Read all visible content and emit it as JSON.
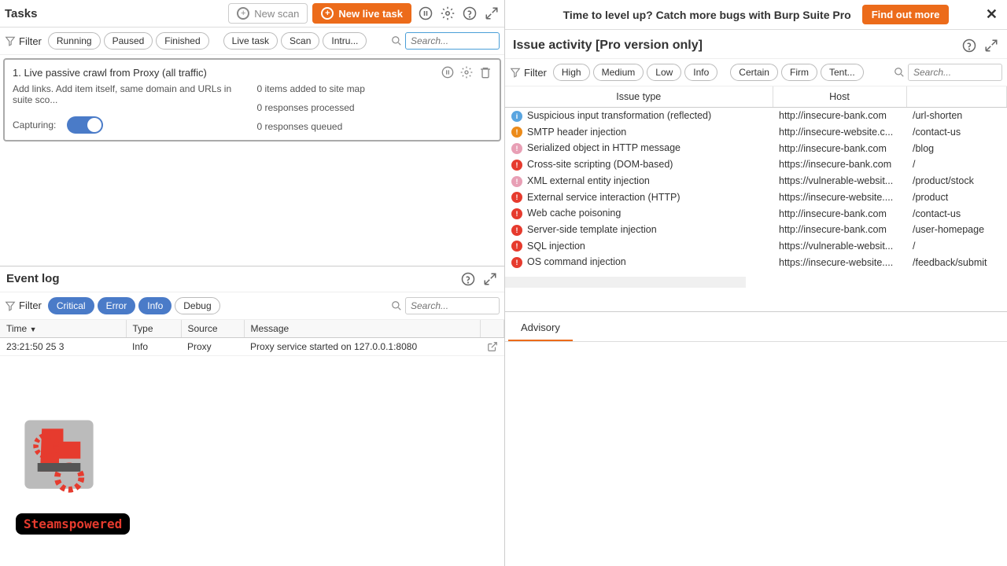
{
  "tasks": {
    "title": "Tasks",
    "new_scan": "New scan",
    "new_live": "New live task",
    "filter_label": "Filter",
    "pills": [
      "Running",
      "Paused",
      "Finished",
      "Live task",
      "Scan",
      "Intru..."
    ],
    "search_placeholder": "Search...",
    "card": {
      "title": "1. Live passive crawl from Proxy (all traffic)",
      "desc": "Add links. Add item itself, same domain and URLs in suite sco...",
      "capturing_label": "Capturing:",
      "stats": [
        "0 items added to site map",
        "0 responses processed",
        "0 responses queued"
      ]
    }
  },
  "eventlog": {
    "title": "Event log",
    "filter_label": "Filter",
    "pills": [
      {
        "label": "Critical",
        "active": true
      },
      {
        "label": "Error",
        "active": true
      },
      {
        "label": "Info",
        "active": true
      },
      {
        "label": "Debug",
        "active": false
      }
    ],
    "search_placeholder": "Search...",
    "columns": [
      "Time",
      "Type",
      "Source",
      "Message"
    ],
    "row": {
      "time": "23:21:50 25        3",
      "type": "Info",
      "source": "Proxy",
      "message": "Proxy service started on 127.0.0.1:8080"
    }
  },
  "promo": {
    "text": "Time to level up? Catch more bugs with Burp Suite Pro",
    "button": "Find out more"
  },
  "issues": {
    "title": "Issue activity [Pro version only]",
    "filter_label": "Filter",
    "sev_pills": [
      "High",
      "Medium",
      "Low",
      "Info"
    ],
    "conf_pills": [
      "Certain",
      "Firm",
      "Tent..."
    ],
    "search_placeholder": "Search...",
    "columns": [
      "Issue type",
      "Host",
      ""
    ],
    "rows": [
      {
        "sev": "info",
        "type": "Suspicious input transformation (reflected)",
        "host": "http://insecure-bank.com",
        "path": "/url-shorten"
      },
      {
        "sev": "m",
        "type": "SMTP header injection",
        "host": "http://insecure-website.c...",
        "path": "/contact-us"
      },
      {
        "sev": "l",
        "type": "Serialized object in HTTP message",
        "host": "http://insecure-bank.com",
        "path": "/blog"
      },
      {
        "sev": "h",
        "type": "Cross-site scripting (DOM-based)",
        "host": "https://insecure-bank.com",
        "path": "/"
      },
      {
        "sev": "l",
        "type": "XML external entity injection",
        "host": "https://vulnerable-websit...",
        "path": "/product/stock"
      },
      {
        "sev": "h",
        "type": "External service interaction (HTTP)",
        "host": "https://insecure-website....",
        "path": "/product"
      },
      {
        "sev": "h",
        "type": "Web cache poisoning",
        "host": "http://insecure-bank.com",
        "path": "/contact-us"
      },
      {
        "sev": "h",
        "type": "Server-side template injection",
        "host": "http://insecure-bank.com",
        "path": "/user-homepage"
      },
      {
        "sev": "h",
        "type": "SQL injection",
        "host": "https://vulnerable-websit...",
        "path": "/"
      },
      {
        "sev": "h",
        "type": "OS command injection",
        "host": "https://insecure-website....",
        "path": "/feedback/submit"
      }
    ],
    "advisory_tab": "Advisory"
  },
  "watermark": "Steamspowered"
}
